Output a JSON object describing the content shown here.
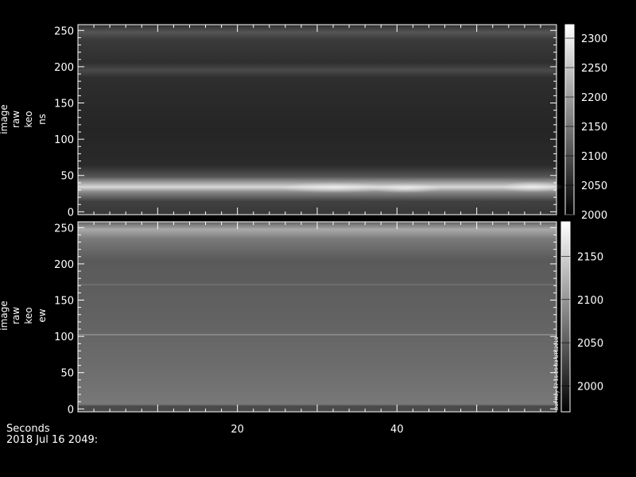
{
  "chart_data": [
    {
      "type": "heatmap",
      "panel": "top",
      "ylabel": [
        "image",
        "raw",
        "keo",
        "ns"
      ],
      "y_ticks": [
        "0",
        "50",
        "100",
        "150",
        "200",
        "250"
      ],
      "y_tick_values": [
        0,
        50,
        100,
        150,
        200,
        250
      ],
      "ylim": [
        -4,
        258
      ],
      "xlim": [
        0,
        60
      ],
      "colorbar": {
        "ticks": [
          "2000",
          "2050",
          "2100",
          "2150",
          "2200",
          "2250",
          "2300"
        ],
        "tick_values": [
          2000,
          2050,
          2100,
          2150,
          2200,
          2250,
          2300
        ],
        "range": [
          2000,
          2323
        ]
      },
      "bands": [
        {
          "y": 36,
          "intensity": 2230
        },
        {
          "y": 190,
          "intensity": 2070
        },
        {
          "y": 248,
          "intensity": 2050
        }
      ]
    },
    {
      "type": "heatmap",
      "panel": "bottom",
      "ylabel": [
        "image",
        "raw",
        "keo",
        "ew"
      ],
      "y_ticks": [
        "0",
        "50",
        "100",
        "150",
        "200",
        "250"
      ],
      "y_tick_values": [
        0,
        50,
        100,
        150,
        200,
        250
      ],
      "ylim": [
        -4,
        258
      ],
      "xlim": [
        0,
        60
      ],
      "x_ticks": [
        "20",
        "40"
      ],
      "x_tick_values": [
        20,
        40
      ],
      "colorbar": {
        "ticks": [
          "2000",
          "2050",
          "2100",
          "2150"
        ],
        "tick_values": [
          2000,
          2050,
          2100,
          2150
        ],
        "range": [
          1970,
          2190
        ],
        "stamp": "Dat May 17 15:29:03 UTC2018"
      },
      "bands": [
        {
          "y": 232,
          "intensity": 2160
        },
        {
          "y": 104,
          "intensity": 2090
        },
        {
          "y": 170,
          "intensity": 2080
        }
      ]
    }
  ],
  "footer": {
    "xlabel": "Seconds",
    "date": "2018 Jul 16 2049:"
  }
}
